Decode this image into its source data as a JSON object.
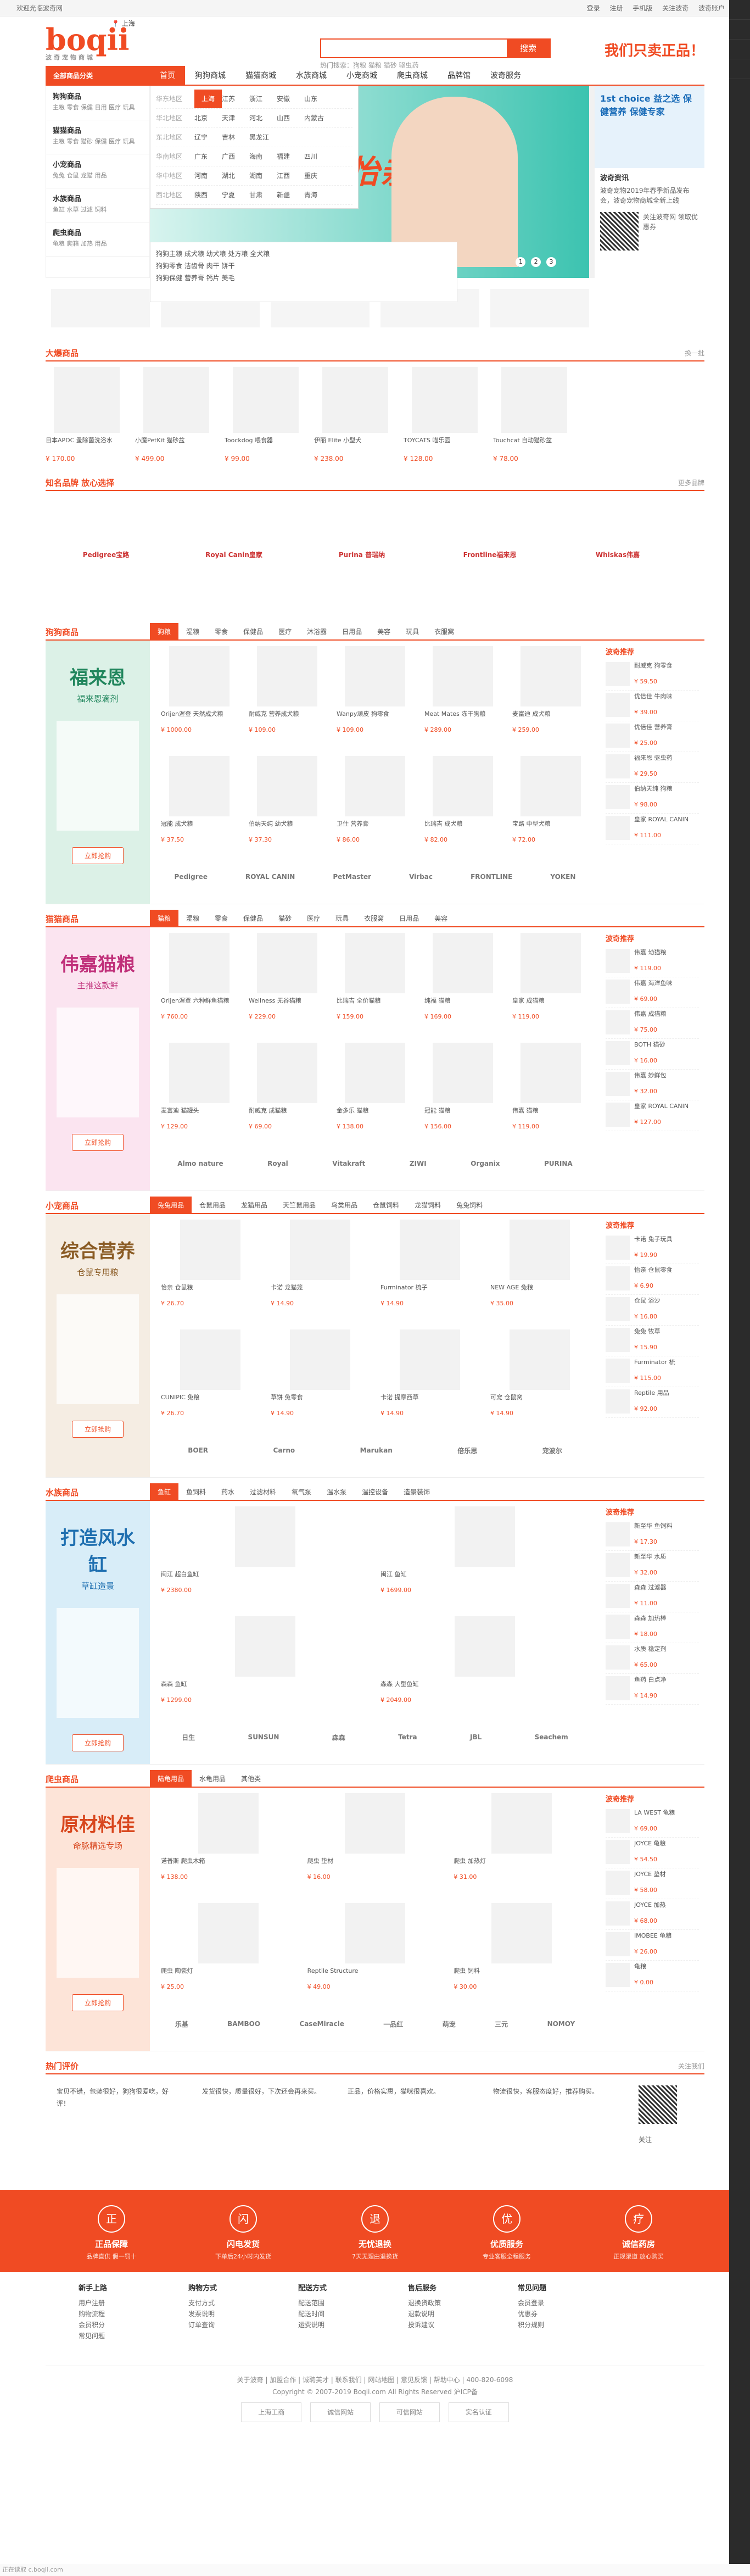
{
  "topbar": {
    "left": "欢迎光临波奇网",
    "right": [
      "登录",
      "注册",
      "手机版",
      "关注波奇",
      "波奇账户"
    ]
  },
  "header": {
    "logo": "boqii",
    "logo_sub": "波奇宠物商城",
    "location": "上海",
    "search_placeholder": "",
    "search_button": "搜索",
    "hot": "热门搜索：狗粮 猫粮 猫砂 驱虫药",
    "slogan": "我们只卖正品！"
  },
  "nav": {
    "all": "全部商品分类",
    "items": [
      "首页",
      "狗狗商城",
      "猫猫商城",
      "水族商城",
      "小宠商城",
      "爬虫商城",
      "品牌馆",
      "波奇服务"
    ],
    "active": 0
  },
  "categories": [
    {
      "title": "狗狗商品",
      "desc": "主粮 零食 保健 日用 医疗 玩具"
    },
    {
      "title": "猫猫商品",
      "desc": "主粮 零食 猫砂 保健 医疗 玩具"
    },
    {
      "title": "小宠商品",
      "desc": "兔兔 仓鼠 龙猫 用品"
    },
    {
      "title": "水族商品",
      "desc": "鱼缸 水草 过滤 饲料"
    },
    {
      "title": "爬虫商品",
      "desc": "龟粮 爬箱 加热 用品"
    }
  ],
  "dropdown": [
    {
      "label": "华东地区",
      "cities": [
        "上海",
        "江苏",
        "浙江",
        "安徽",
        "山东"
      ],
      "current": 0
    },
    {
      "label": "华北地区",
      "cities": [
        "北京",
        "天津",
        "河北",
        "山西",
        "内蒙古"
      ]
    },
    {
      "label": "东北地区",
      "cities": [
        "辽宁",
        "吉林",
        "黑龙江"
      ]
    },
    {
      "label": "华南地区",
      "cities": [
        "广东",
        "广西",
        "海南",
        "福建",
        "四川"
      ]
    },
    {
      "label": "华中地区",
      "cities": [
        "河南",
        "湖北",
        "湖南",
        "江西",
        "重庆"
      ]
    },
    {
      "label": "西北地区",
      "cities": [
        "陕西",
        "宁夏",
        "甘肃",
        "新疆",
        "青海"
      ]
    }
  ],
  "submenu": {
    "rows": [
      "狗狗主粮 成犬粮 幼犬粮 处方粮 全犬粮",
      "狗狗零食 洁齿骨 肉干 饼干",
      "狗狗保健 营养膏 钙片 美毛"
    ]
  },
  "banner": {
    "headline": "养宠安心选怡亲",
    "dots": [
      "1",
      "2",
      "3"
    ]
  },
  "rightcol": {
    "ad": "1st choice 益之选 保健营养 保健专家",
    "news_title": "波奇资讯",
    "news": "波奇宠物2019年春季新品发布会，波奇宠物商城全新上线",
    "qr_text": "关注波奇网 领取优惠券"
  },
  "hot_title": "大爆商品",
  "hot_more": "换一批",
  "hot_items": [
    {
      "t": "日本APDC 蚤除菌洗浴水",
      "p": "¥ 170.00"
    },
    {
      "t": "小魔PetKit 猫砂盆",
      "p": "¥ 499.00"
    },
    {
      "t": "Toockdog 喂食器",
      "p": "¥ 99.00"
    },
    {
      "t": "伊丽 Elite 小型犬",
      "p": "¥ 238.00"
    },
    {
      "t": "TOYCATS 喵乐园",
      "p": "¥ 128.00"
    },
    {
      "t": "Touchcat 自动猫砂盆",
      "p": "¥ 78.00"
    }
  ],
  "brand_title": "知名品牌 放心选择",
  "brand_more": "更多品牌",
  "brands": [
    "Pedigree宝路",
    "Royal Canin皇家",
    "Purina 普瑞纳",
    "Frontline福来恩",
    "Whiskas伟嘉"
  ],
  "floors": [
    {
      "title": "狗狗商品",
      "left_h": "福来恩",
      "left_p": "福来恩滴剂",
      "btn": "立即抢购",
      "tabs": [
        "狗粮",
        "湿粮",
        "零食",
        "保健品",
        "医疗",
        "沐浴露",
        "日用品",
        "美容",
        "玩具",
        "衣服窝"
      ],
      "items": [
        {
          "t": "Orijen渥登 天然成犬粮",
          "p": "¥ 1000.00"
        },
        {
          "t": "耐威克 营养成犬粮",
          "p": "¥ 109.00"
        },
        {
          "t": "Wanpy顽皮 狗零食",
          "p": "¥ 109.00"
        },
        {
          "t": "Meat Mates 冻干狗粮",
          "p": "¥ 289.00"
        },
        {
          "t": "麦富迪 成犬粮",
          "p": "¥ 259.00"
        },
        {
          "t": "冠能 成犬粮",
          "p": "¥ 37.50"
        },
        {
          "t": "伯纳天纯 幼犬粮",
          "p": "¥ 37.30"
        },
        {
          "t": "卫仕 营养膏",
          "p": "¥ 86.00"
        },
        {
          "t": "比瑞吉 成犬粮",
          "p": "¥ 82.00"
        },
        {
          "t": "宝路 中型犬粮",
          "p": "¥ 72.00"
        }
      ],
      "brands": [
        "Pedigree",
        "ROYAL CANIN",
        "PetMaster",
        "Virbac",
        "FRONTLINE",
        "YOKEN"
      ],
      "rec": [
        {
          "t": "耐威克 狗零食",
          "p": "¥ 59.50"
        },
        {
          "t": "优倍佳 牛肉味",
          "p": "¥ 39.00"
        },
        {
          "t": "优倍佳 营养膏",
          "p": "¥ 25.00"
        },
        {
          "t": "福来恩 驱虫药",
          "p": "¥ 29.50"
        },
        {
          "t": "伯纳天纯 狗粮",
          "p": "¥ 98.00"
        },
        {
          "t": "皇家 ROYAL CANIN",
          "p": "¥ 111.00"
        }
      ]
    },
    {
      "title": "猫猫商品",
      "left_h": "伟嘉猫粮",
      "left_p": "主推这款鲜",
      "btn": "立即抢购",
      "tabs": [
        "猫粮",
        "湿粮",
        "零食",
        "保健品",
        "猫砂",
        "医疗",
        "玩具",
        "衣服窝",
        "日用品",
        "美容"
      ],
      "items": [
        {
          "t": "Orijen渥登 六种鲜鱼猫粮",
          "p": "¥ 760.00"
        },
        {
          "t": "Wellness 无谷猫粮",
          "p": "¥ 229.00"
        },
        {
          "t": "比瑞吉 全价猫粮",
          "p": "¥ 159.00"
        },
        {
          "t": "纯福 猫粮",
          "p": "¥ 169.00"
        },
        {
          "t": "皇家 成猫粮",
          "p": "¥ 119.00"
        },
        {
          "t": "麦富迪 猫罐头",
          "p": "¥ 129.00"
        },
        {
          "t": "耐威克 成猫粮",
          "p": "¥ 69.00"
        },
        {
          "t": "金多乐 猫粮",
          "p": "¥ 138.00"
        },
        {
          "t": "冠能 猫粮",
          "p": "¥ 156.00"
        },
        {
          "t": "伟嘉 猫粮",
          "p": "¥ 119.00"
        }
      ],
      "brands": [
        "Almo nature",
        "Royal",
        "Vitakraft",
        "ZIWI",
        "Organix",
        "PURINA"
      ],
      "rec": [
        {
          "t": "伟嘉 幼猫粮",
          "p": "¥ 119.00"
        },
        {
          "t": "伟嘉 海洋鱼味",
          "p": "¥ 69.00"
        },
        {
          "t": "伟嘉 成猫粮",
          "p": "¥ 75.00"
        },
        {
          "t": "BOTH 猫砂",
          "p": "¥ 16.00"
        },
        {
          "t": "伟嘉 妙鲜包",
          "p": "¥ 32.00"
        },
        {
          "t": "皇家 ROYAL CANIN",
          "p": "¥ 127.00"
        }
      ]
    },
    {
      "title": "小宠商品",
      "left_h": "综合营养",
      "left_p": "仓鼠专用粮",
      "btn": "立即抢购",
      "tabs": [
        "兔兔用品",
        "仓鼠用品",
        "龙猫用品",
        "天竺鼠用品",
        "鸟类用品",
        "仓鼠饲料",
        "龙猫饲料",
        "兔兔饲料"
      ],
      "items": [
        {
          "t": "怡亲 仓鼠粮",
          "p": "¥ 26.70"
        },
        {
          "t": "卡诺 龙猫笼",
          "p": "¥ 14.90"
        },
        {
          "t": "Furminator 梳子",
          "p": "¥ 14.90"
        },
        {
          "t": "NEW AGE 兔粮",
          "p": "¥ 35.00"
        },
        {
          "t": "CUNIPIC 兔粮",
          "p": "¥ 26.70"
        },
        {
          "t": "草饼 兔零食",
          "p": "¥ 14.90"
        },
        {
          "t": "卡诺 提摩西草",
          "p": "¥ 14.90"
        },
        {
          "t": "可宠 仓鼠窝",
          "p": "¥ 14.90"
        }
      ],
      "brands": [
        "BOER",
        "Carno",
        "Marukan",
        "倍乐思",
        "宠波尔"
      ],
      "rec": [
        {
          "t": "卡诺 兔子玩具",
          "p": "¥ 19.90"
        },
        {
          "t": "怡亲 仓鼠零食",
          "p": "¥ 6.90"
        },
        {
          "t": "仓鼠 浴沙",
          "p": "¥ 16.80"
        },
        {
          "t": "兔兔 牧草",
          "p": "¥ 15.90"
        },
        {
          "t": "Furminator 梳",
          "p": "¥ 115.00"
        },
        {
          "t": "Reptile 用品",
          "p": "¥ 92.00"
        }
      ]
    },
    {
      "title": "水族商品",
      "left_h": "打造风水缸",
      "left_p": "草缸造景",
      "btn": "立即抢购",
      "tabs": [
        "鱼缸",
        "鱼饲料",
        "药水",
        "过滤材料",
        "氧气泵",
        "温水泵",
        "温控设备",
        "造景装饰"
      ],
      "items": [
        {
          "t": "闽江 超白鱼缸",
          "p": "¥ 2380.00"
        },
        {
          "t": "闽江 鱼缸",
          "p": "¥ 1699.00"
        },
        {
          "t": "森森 鱼缸",
          "p": "¥ 1299.00"
        },
        {
          "t": "森森 大型鱼缸",
          "p": "¥ 2049.00"
        }
      ],
      "brands": [
        "日生",
        "SUNSUN",
        "森森",
        "Tetra",
        "JBL",
        "Seachem"
      ],
      "rec": [
        {
          "t": "新至华 鱼饲料",
          "p": "¥ 17.30"
        },
        {
          "t": "新至华 水质",
          "p": "¥ 32.00"
        },
        {
          "t": "森森 过滤器",
          "p": "¥ 11.00"
        },
        {
          "t": "森森 加热棒",
          "p": "¥ 18.00"
        },
        {
          "t": "水质 稳定剂",
          "p": "¥ 65.00"
        },
        {
          "t": "鱼药 白点净",
          "p": "¥ 14.90"
        }
      ]
    },
    {
      "title": "爬虫商品",
      "left_h": "原材料佳",
      "left_p": "命脉精选专场",
      "btn": "立即抢购",
      "tabs": [
        "陆龟用品",
        "水龟用品",
        "其他类"
      ],
      "items": [
        {
          "t": "诺普斯 爬虫木箱",
          "p": "¥ 138.00"
        },
        {
          "t": "爬虫 垫材",
          "p": "¥ 16.00"
        },
        {
          "t": "爬虫 加热灯",
          "p": "¥ 31.00"
        },
        {
          "t": "爬虫 陶瓷灯",
          "p": "¥ 25.00"
        },
        {
          "t": "Reptile Structure",
          "p": "¥ 49.00"
        },
        {
          "t": "爬虫 饲料",
          "p": "¥ 30.00"
        }
      ],
      "brands": [
        "乐基",
        "BAMBOO",
        "CaseMiracle",
        "一品红",
        "萌宠",
        "三元",
        "NOMOY"
      ],
      "rec": [
        {
          "t": "LA WEST 龟粮",
          "p": "¥ 69.00"
        },
        {
          "t": "JOYCE 龟粮",
          "p": "¥ 54.50"
        },
        {
          "t": "JOYCE 垫材",
          "p": "¥ 58.00"
        },
        {
          "t": "JOYCE 加热",
          "p": "¥ 68.00"
        },
        {
          "t": "IMOBEE 龟粮",
          "p": "¥ 26.00"
        },
        {
          "t": "龟粮",
          "p": "¥ 0.00"
        }
      ]
    }
  ],
  "review": {
    "title": "热门评价",
    "follow_title": "关注我们",
    "items": [
      "宝贝不错，包装很好，狗狗很爱吃，好评！",
      "发货很快，质量很好，下次还会再来买。",
      "正品，价格实惠，猫咪很喜欢。",
      "物流很快，客服态度好，推荐购买。"
    ],
    "follow": "关注"
  },
  "services": [
    {
      "i": "正",
      "b": "正品保障",
      "p": "品牌直供 假一罚十"
    },
    {
      "i": "闪",
      "b": "闪电发货",
      "p": "下单后24小时内发货"
    },
    {
      "i": "退",
      "b": "无忧退换",
      "p": "7天无理由退换货"
    },
    {
      "i": "优",
      "b": "优质服务",
      "p": "专业客服全程服务"
    },
    {
      "i": "疗",
      "b": "诚信药房",
      "p": "正规渠道 放心购买"
    }
  ],
  "help": [
    {
      "h": "新手上路",
      "items": [
        "用户注册",
        "购物流程",
        "会员积分",
        "常见问题"
      ]
    },
    {
      "h": "购物方式",
      "items": [
        "支付方式",
        "发票说明",
        "订单查询"
      ]
    },
    {
      "h": "配送方式",
      "items": [
        "配送范围",
        "配送时间",
        "运费说明"
      ]
    },
    {
      "h": "售后服务",
      "items": [
        "退换货政策",
        "退款说明",
        "投诉建议"
      ]
    },
    {
      "h": "常见问题",
      "items": [
        "会员登录",
        "优惠券",
        "积分规则"
      ]
    }
  ],
  "footer": {
    "links": "关于波奇 | 加盟合作 | 诚聘英才 | 联系我们 | 网站地图 | 意见反馈 | 帮助中心 | 400-820-6098",
    "copy": "Copyright © 2007-2019 Boqii.com All Rights Reserved 沪ICP备",
    "badges": [
      "上海工商",
      "诚信网站",
      "可信网站",
      "实名认证"
    ]
  },
  "statusbar": "正在读取 c.boqii.com"
}
